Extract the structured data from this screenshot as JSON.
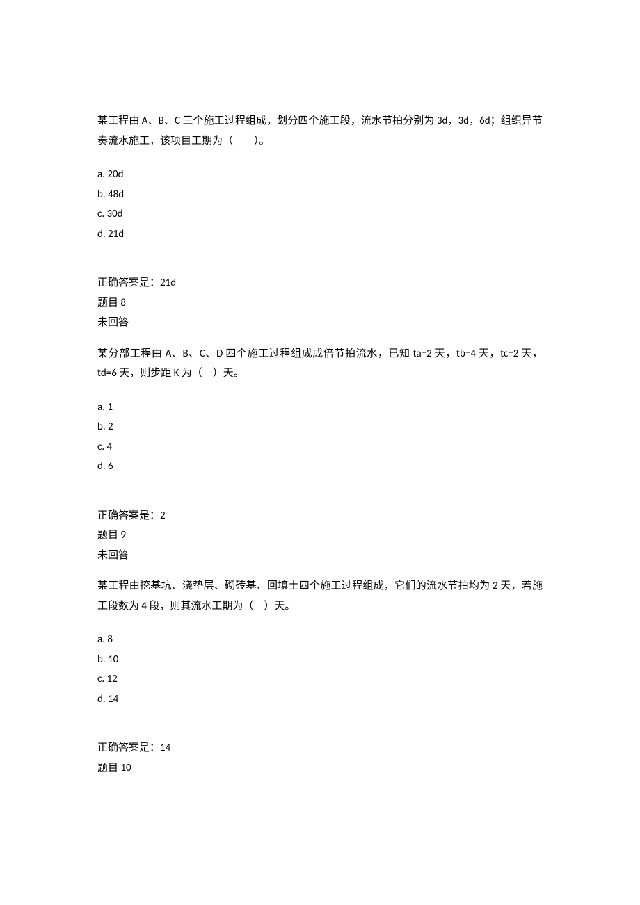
{
  "questions": [
    {
      "text": "某工程由 A、B、C 三个施工过程组成，划分四个施工段，流水节拍分别为 3d，3d，6d；组织异节奏流水施工，该项目工期为（　　）。",
      "options": {
        "a": "a. 20d",
        "b": "b. 48d",
        "c": "c. 30d",
        "d": "d. 21d"
      },
      "answer": "正确答案是：21d",
      "next_label": "题目 8",
      "status": "未回答"
    },
    {
      "text": "某分部工程由 A、B、C、D 四个施工过程组成成倍节拍流水，已知 ta=2 天，tb=4 天，tc=2 天，td=6 天，则步距 K 为（　）天。",
      "options": {
        "a": "a. 1",
        "b": "b. 2",
        "c": "c. 4",
        "d": "d. 6"
      },
      "answer": "正确答案是：2",
      "next_label": "题目 9",
      "status": "未回答"
    },
    {
      "text": "某工程由挖基坑、浇垫层、砌砖基、回填土四个施工过程组成，它们的流水节拍均为 2 天，若施工段数为 4 段，则其流水工期为（　）天。",
      "options": {
        "a": "a. 8",
        "b": "b. 10",
        "c": "c. 12",
        "d": "d. 14"
      },
      "answer": "正确答案是：14",
      "next_label": "题目 10",
      "status": ""
    }
  ]
}
